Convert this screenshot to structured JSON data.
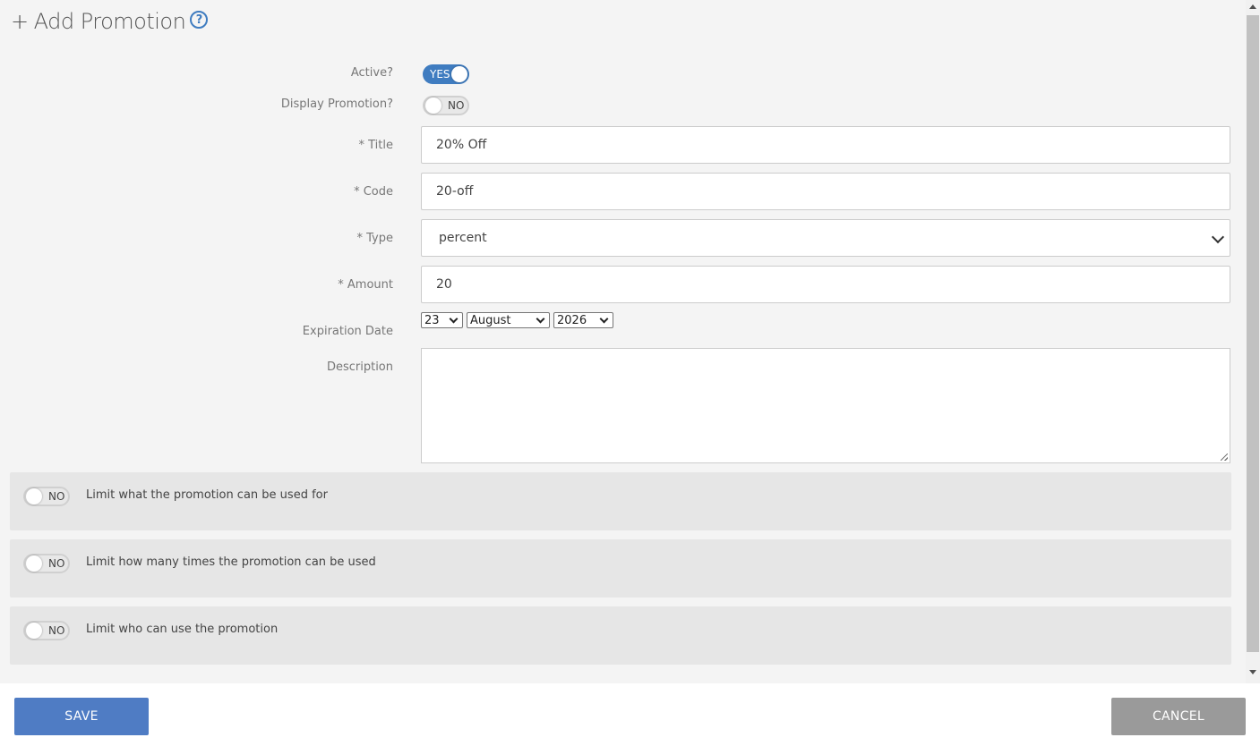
{
  "header": {
    "plus": "+",
    "title": "Add Promotion",
    "help": "?"
  },
  "form": {
    "active": {
      "label": "Active?",
      "value": "YES"
    },
    "display": {
      "label": "Display Promotion?",
      "value": "NO"
    },
    "title": {
      "label": "* Title",
      "value": "20% Off"
    },
    "code": {
      "label": "* Code",
      "value": "20-off"
    },
    "type": {
      "label": "* Type",
      "value": "percent"
    },
    "amount": {
      "label": "* Amount",
      "value": "20"
    },
    "expiration": {
      "label": "Expiration Date",
      "day": "23",
      "month": "August",
      "year": "2026"
    },
    "description": {
      "label": "Description",
      "value": ""
    }
  },
  "limits": [
    {
      "toggle": "NO",
      "text": "Limit what the promotion can be used for"
    },
    {
      "toggle": "NO",
      "text": "Limit how many times the promotion can be used"
    },
    {
      "toggle": "NO",
      "text": "Limit who can use the promotion"
    }
  ],
  "footer": {
    "save": "SAVE",
    "cancel": "CANCEL"
  },
  "colors": {
    "accent": "#3f7cc0",
    "save": "#4f7cc4",
    "cancel": "#9a9a9a"
  }
}
